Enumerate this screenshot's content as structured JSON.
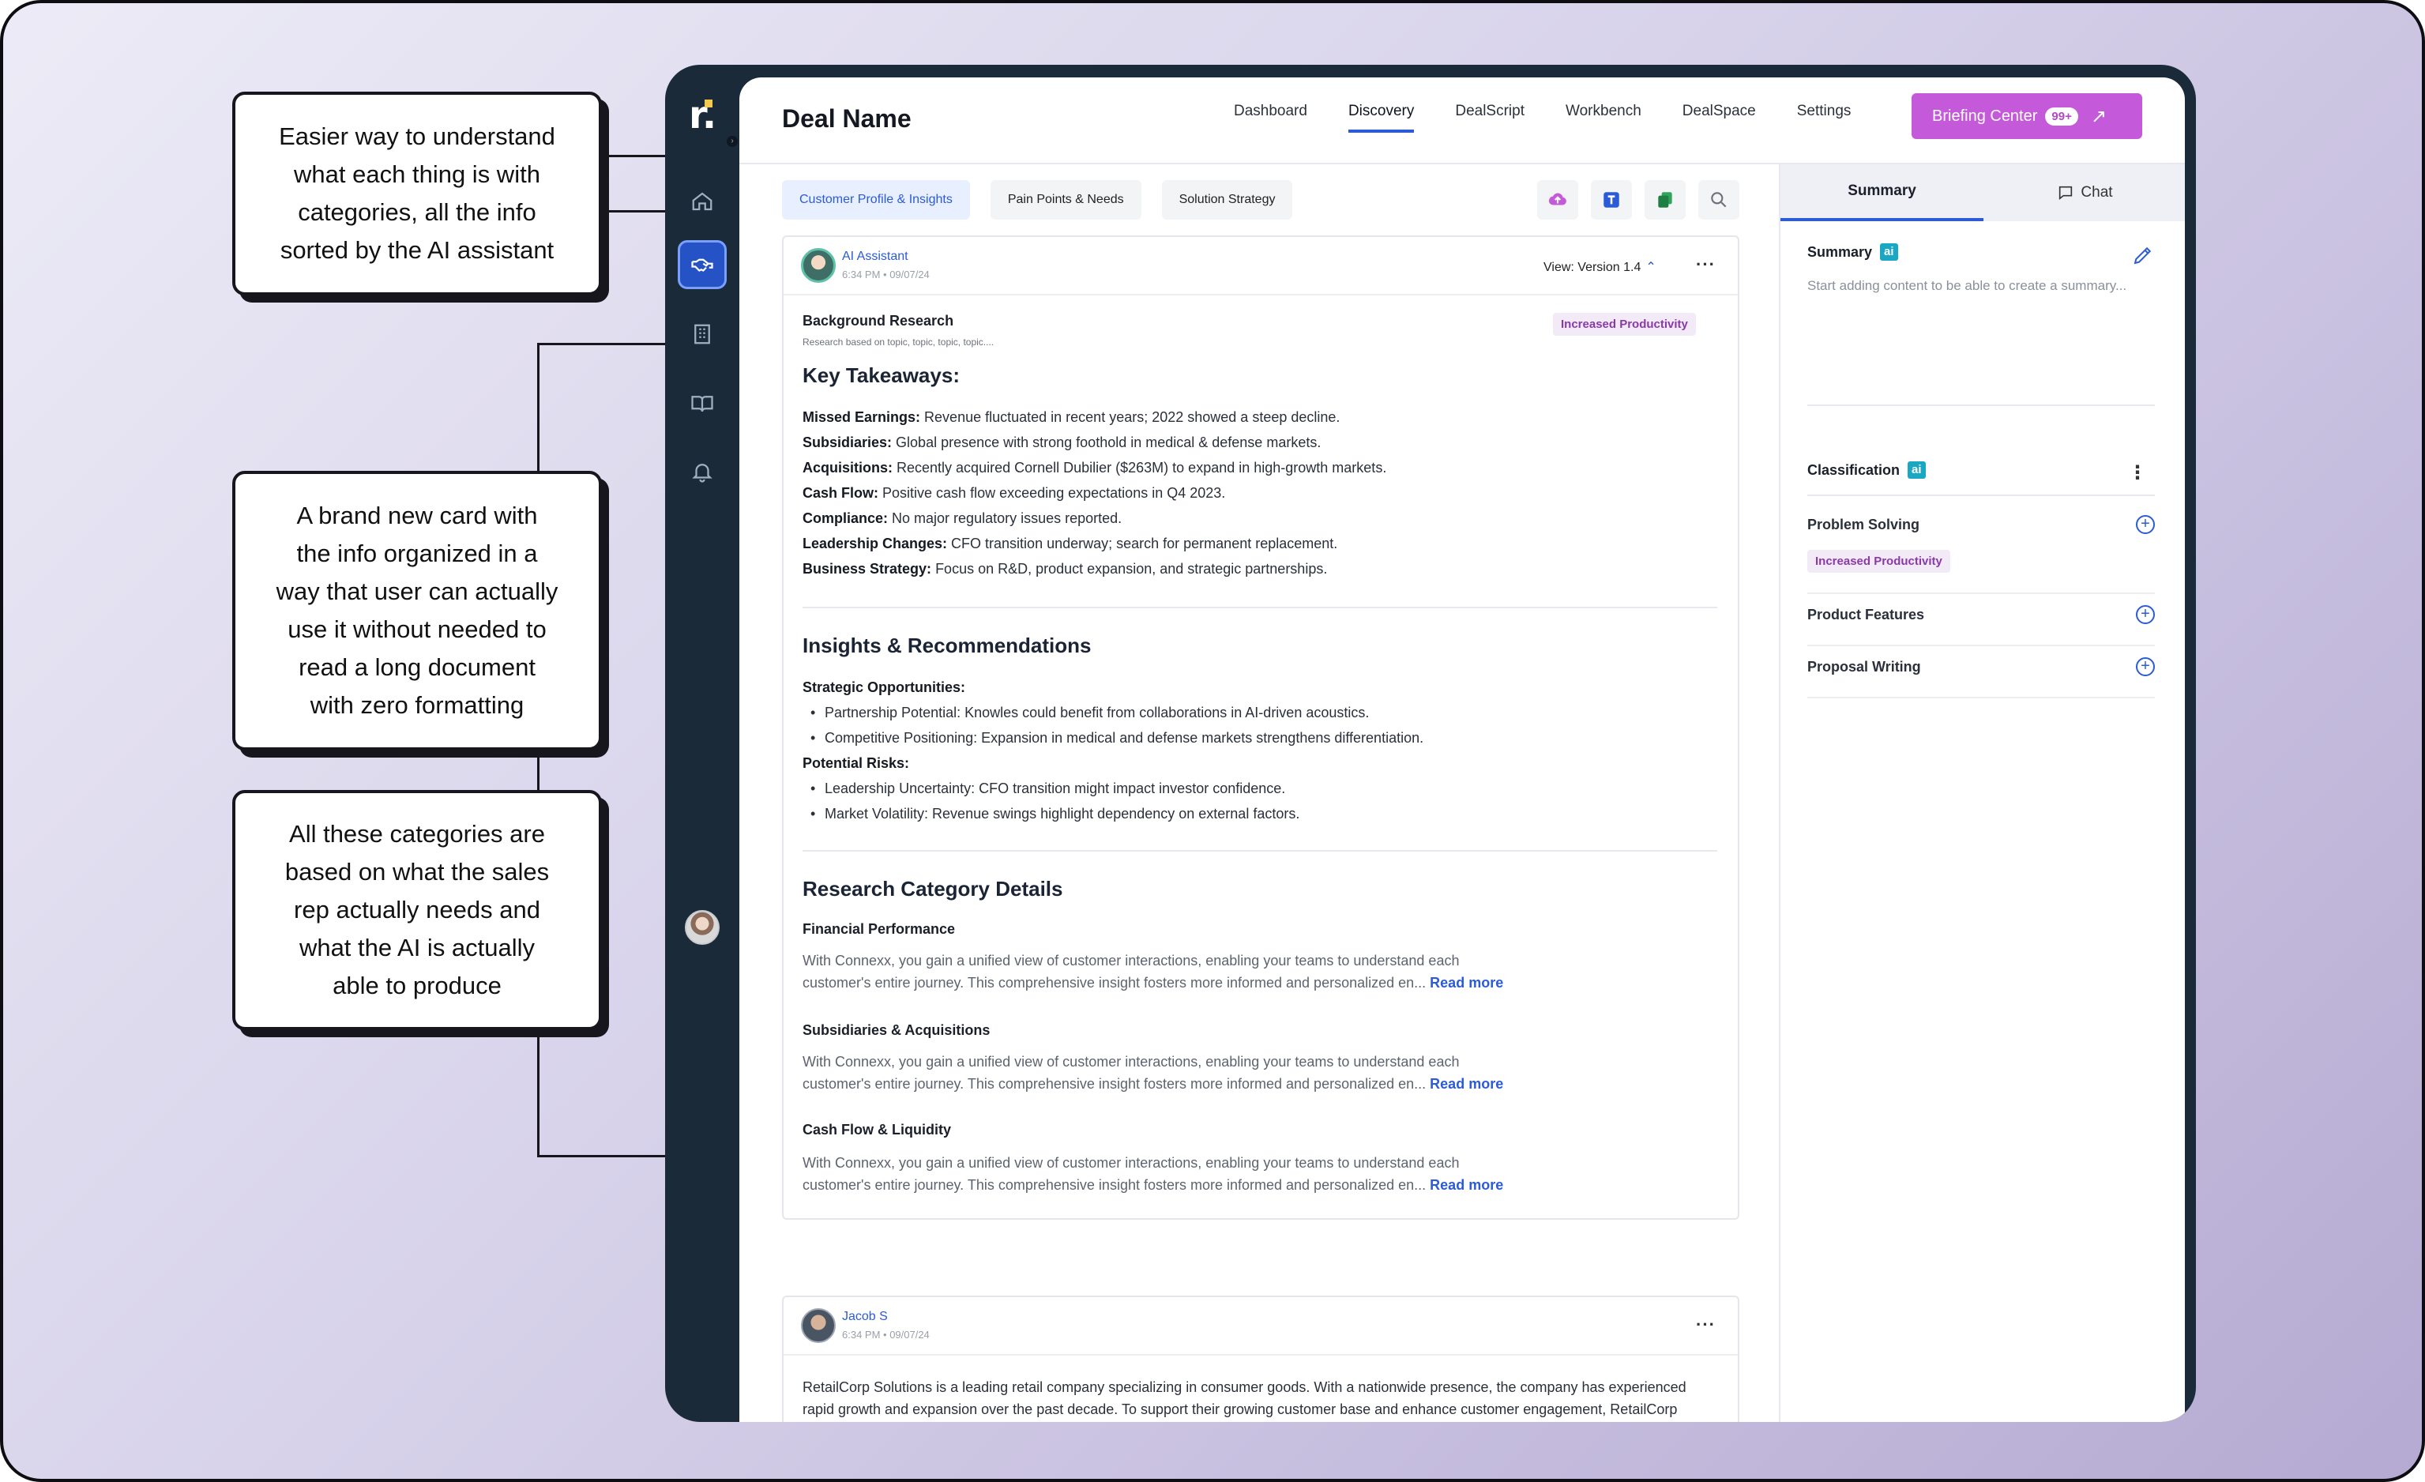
{
  "callouts": {
    "one": [
      "Easier way to understand",
      "what each thing is with",
      "categories, all the info",
      "sorted by the AI assistant"
    ],
    "two": [
      "A brand new card with",
      "the info organized in a",
      "way that user can actually",
      "use it without needed to",
      "read a long document",
      "with zero formatting"
    ],
    "three": [
      "All these categories are",
      "based on what the sales",
      "rep actually needs and",
      "what the AI is actually",
      "able to produce"
    ]
  },
  "sidebar": {
    "logo": "r.",
    "items": [
      {
        "icon": "home-icon"
      },
      {
        "icon": "handshake-icon",
        "active": true
      },
      {
        "icon": "building-icon"
      },
      {
        "icon": "book-icon"
      },
      {
        "icon": "bell-icon"
      }
    ]
  },
  "header": {
    "deal_name": "Deal Name",
    "nav": [
      "Dashboard",
      "Discovery",
      "DealScript",
      "Workbench",
      "DealSpace",
      "Settings"
    ],
    "active_nav": "Discovery",
    "briefing_label": "Briefing Center",
    "briefing_badge": "99+"
  },
  "tabs": [
    "Customer Profile & Insights",
    "Pain Points & Needs",
    "Solution Strategy"
  ],
  "card1": {
    "author": "AI Assistant",
    "stamp": "6:34 PM • 09/07/24",
    "version": "View: Version 1.4",
    "more": "···",
    "bg_title": "Background Research",
    "bg_sub": "Research based on topic, topic, topic, topic....",
    "pill": "Increased Productivity",
    "key_title": "Key Takeaways:",
    "key_items": [
      {
        "label": "Missed Earnings:",
        "text": " Revenue fluctuated in recent years; 2022 showed a steep decline."
      },
      {
        "label": "Subsidiaries:",
        "text": " Global presence with strong foothold in medical & defense markets."
      },
      {
        "label": "Acquisitions:",
        "text": " Recently acquired Cornell Dubilier ($263M) to expand in high-growth markets."
      },
      {
        "label": "Cash Flow:",
        "text": " Positive cash flow exceeding expectations in Q4 2023."
      },
      {
        "label": "Compliance:",
        "text": " No major regulatory issues reported."
      },
      {
        "label": "Leadership Changes:",
        "text": " CFO transition underway; search for permanent replacement."
      },
      {
        "label": "Business Strategy:",
        "text": " Focus on R&D, product expansion, and strategic partnerships."
      }
    ],
    "insights_title": "Insights & Recommendations",
    "opp_title": "Strategic Opportunities:",
    "opp_items": [
      "Partnership Potential: Knowles could benefit from collaborations in AI-driven acoustics.",
      "Competitive Positioning: Expansion in medical and defense markets strengthens differentiation."
    ],
    "risk_title": "Potential Risks:",
    "risk_items": [
      "Leadership Uncertainty: CFO transition might impact investor confidence.",
      "Market Volatility: Revenue swings highlight dependency on external factors."
    ],
    "research_title": "Research Category Details",
    "categories": [
      {
        "title": "Financial Performance",
        "line1": "With Connexx, you gain a unified view of customer interactions, enabling your teams to understand each",
        "line2": "customer's entire journey. This comprehensive insight fosters more informed and personalized en...",
        "more": "Read more"
      },
      {
        "title": "Subsidiaries & Acquisitions",
        "line1": "With Connexx, you gain a unified view of customer interactions, enabling your teams to understand each",
        "line2": "customer's entire journey. This comprehensive insight fosters more informed and personalized en...",
        "more": "Read more"
      },
      {
        "title": "Cash Flow & Liquidity",
        "line1": "With Connexx, you gain a unified view of customer interactions, enabling your teams to understand each",
        "line2": "customer's entire journey. This comprehensive insight fosters more informed and personalized en...",
        "more": "Read more"
      }
    ]
  },
  "card2": {
    "author": "Jacob S",
    "stamp": "6:34 PM • 09/07/24",
    "more": "···",
    "body": "RetailCorp Solutions is a leading retail company specializing in consumer goods. With a nationwide presence, the company has experienced rapid growth and expansion over the past decade. To support their growing customer base and enhance customer engagement, RetailCorp Solutions requires an advanced CRM system."
  },
  "right": {
    "tab_summary": "Summary",
    "tab_chat": "Chat",
    "summary_title": "Summary",
    "ai": "ai",
    "summary_text": "Start adding content to be able to create a summary...",
    "classification_title": "Classification",
    "rows": [
      {
        "label": "Problem Solving",
        "pill": "Increased Productivity"
      },
      {
        "label": "Product Features"
      },
      {
        "label": "Proposal Writing"
      }
    ]
  },
  "colors": {
    "accent": "#2b5bd7",
    "briefing": "#c45ad9",
    "sidebar": "#1a2a39",
    "pill_text": "#8a3aa8",
    "ai_badge": "#19a7c4"
  }
}
